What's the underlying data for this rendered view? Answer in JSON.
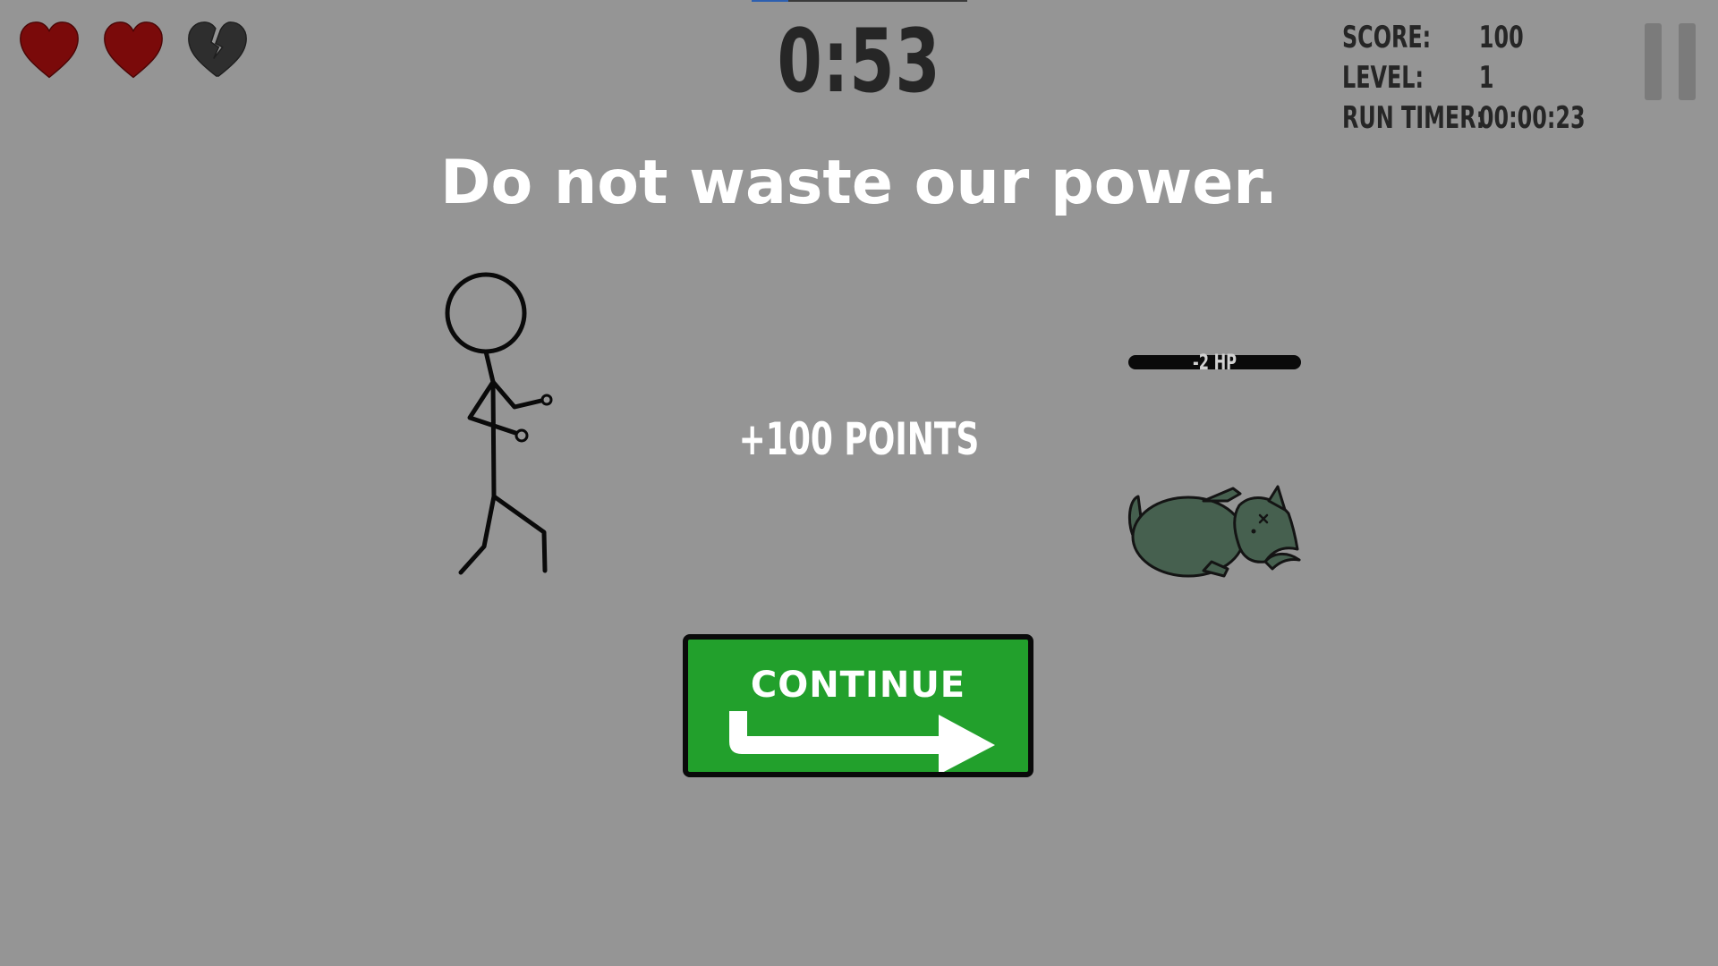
{
  "hud": {
    "lives": [
      {
        "state": "full",
        "icon": "heart-icon",
        "color": "#7a0a0a"
      },
      {
        "state": "full",
        "icon": "heart-icon",
        "color": "#7a0a0a"
      },
      {
        "state": "broken",
        "icon": "broken-heart-icon",
        "color": "#2e2e2e"
      }
    ],
    "timer": "0:53",
    "stats": [
      {
        "label": "SCORE:",
        "value": "100"
      },
      {
        "label": "LEVEL:",
        "value": "1"
      },
      {
        "label": "RUN TIMER:",
        "value": "00:00:23"
      }
    ],
    "pause_icon": "pause-icon",
    "top_progress_fraction": 0.17
  },
  "message": "Do not waste our power.",
  "points_popup": "+100 POINTS",
  "enemy": {
    "hp_text": "-2 HP",
    "state": "defeated",
    "color": "#46604f"
  },
  "continue_button": {
    "label": "CONTINUE",
    "icon": "arrow-right-icon",
    "color": "#22a02c"
  }
}
